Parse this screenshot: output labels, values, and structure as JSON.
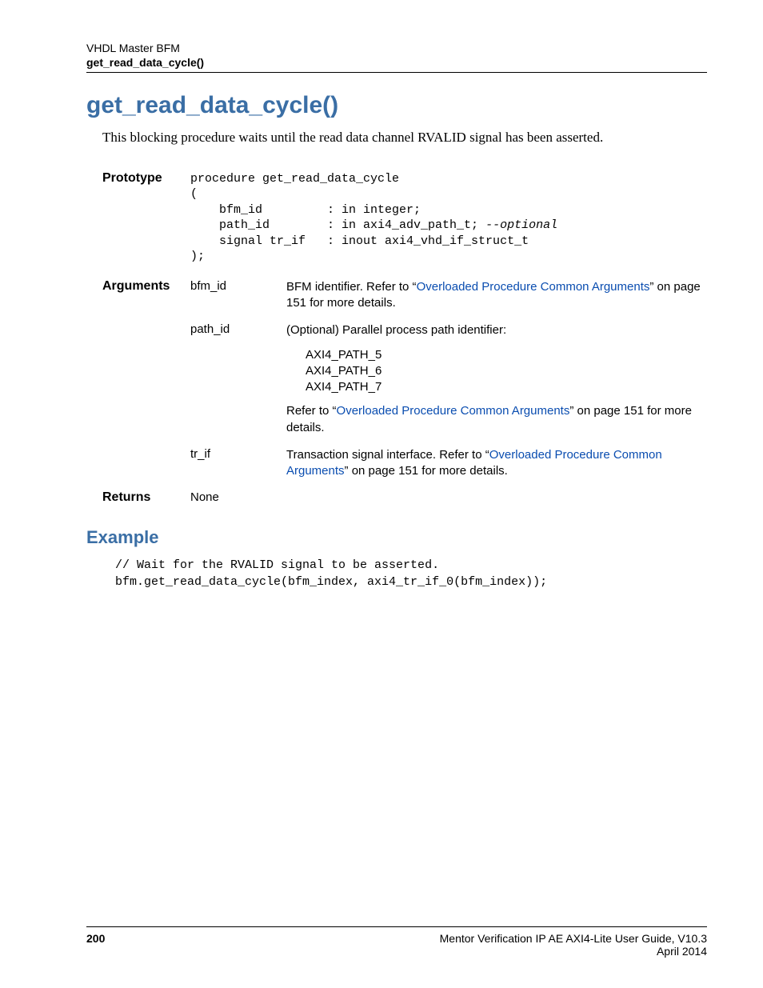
{
  "header": {
    "running_title": "VHDL Master BFM",
    "running_sub": "get_read_data_cycle()"
  },
  "title": "get_read_data_cycle()",
  "intro": "This blocking procedure waits until the read data channel RVALID signal has been asserted.",
  "prototype": {
    "label": "Prototype",
    "line1": "procedure get_read_data_cycle",
    "line2": "(",
    "line3a": "    bfm_id         : in integer;",
    "line3b_pre": "    path_id        : in axi4_adv_path_t; ",
    "line3b_comment": "--optional",
    "line3c": "    signal tr_if   : inout axi4_vhd_if_struct_t",
    "line4": ");"
  },
  "arguments": {
    "label": "Arguments",
    "items": [
      {
        "name": "bfm_id",
        "desc_pre": "BFM identifier. Refer to “",
        "link": "Overloaded Procedure Common Arguments",
        "desc_post": "” on page 151 for more details."
      },
      {
        "name": "path_id",
        "desc_intro": "(Optional) Parallel process path identifier:",
        "paths": [
          "AXI4_PATH_5",
          "AXI4_PATH_6",
          "AXI4_PATH_7"
        ],
        "refer_pre": "Refer to “",
        "refer_link": "Overloaded Procedure Common Arguments",
        "refer_post": "” on page 151 for more details."
      },
      {
        "name": "tr_if",
        "desc_pre": "Transaction signal interface. Refer to “",
        "link": "Overloaded Procedure Common Arguments",
        "desc_post": "” on page 151 for more details."
      }
    ]
  },
  "returns": {
    "label": "Returns",
    "value": "None"
  },
  "example": {
    "heading": "Example",
    "line1": "// Wait for the RVALID signal to be asserted.",
    "line2": "bfm.get_read_data_cycle(bfm_index, axi4_tr_if_0(bfm_index));"
  },
  "footer": {
    "page": "200",
    "right1": "Mentor Verification IP AE AXI4-Lite User Guide, V10.3",
    "right2": "April 2014"
  }
}
